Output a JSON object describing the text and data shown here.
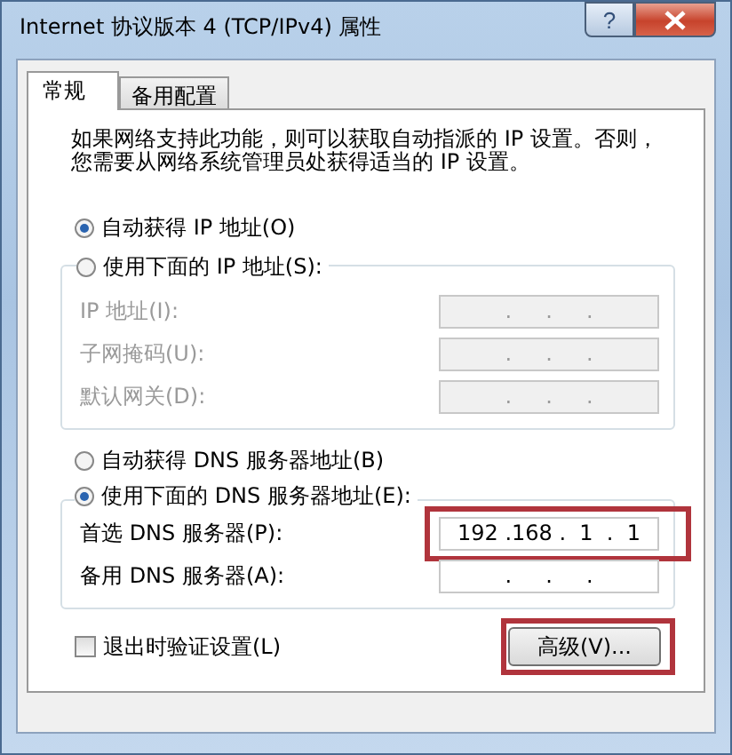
{
  "window": {
    "title": "Internet 协议版本 4 (TCP/IPv4) 属性",
    "help": "?"
  },
  "tabs": [
    {
      "label": "常规",
      "selected": true
    },
    {
      "label": "备用配置",
      "selected": false
    }
  ],
  "description": [
    "如果网络支持此功能，则可以获取自动指派的 IP 设置。否则，",
    "您需要从网络系统管理员处获得适当的 IP 设置。"
  ],
  "ip_mode": [
    {
      "label": "自动获得 IP 地址(O)",
      "selected": true
    },
    {
      "label": "使用下面的 IP 地址(S):",
      "selected": false
    }
  ],
  "ip_fields": [
    {
      "label": "IP 地址(I):",
      "value": ".     .     .",
      "disabled": true
    },
    {
      "label": "子网掩码(U):",
      "value": ".     .     .",
      "disabled": true
    },
    {
      "label": "默认网关(D):",
      "value": ".     .     .",
      "disabled": true
    }
  ],
  "dns_mode": [
    {
      "label": "自动获得 DNS 服务器地址(B)",
      "selected": false
    },
    {
      "label": "使用下面的 DNS 服务器地址(E):",
      "selected": true
    }
  ],
  "dns_fields": [
    {
      "label": "首选 DNS 服务器(P):",
      "value": "192 .168 .  1  .  1",
      "disabled": false,
      "highlighted": true
    },
    {
      "label": "备用 DNS 服务器(A):",
      "value": ".     .     .",
      "disabled": false,
      "highlighted": false
    }
  ],
  "validate": {
    "label": "退出时验证设置(L)",
    "checked": false
  },
  "advanced_button": {
    "label": "高级(V)...",
    "highlighted": true
  }
}
